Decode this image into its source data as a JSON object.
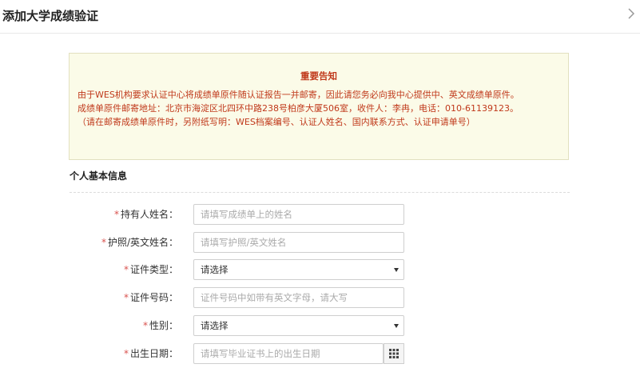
{
  "header": {
    "title": "添加大学成绩验证"
  },
  "notice": {
    "title": "重要告知",
    "lines": [
      "由于WES机构要求认证中心将成绩单原件随认证报告一并邮寄，因此请您务必向我中心提供中、英文成绩单原件。",
      "成绩单原件邮寄地址：北京市海淀区北四环中路238号柏彦大厦506室，收件人：李冉，电话：010-61139123。",
      "（请在邮寄成绩单原件时，另附纸写明：WES档案编号、认证人姓名、国内联系方式、认证申请单号）"
    ]
  },
  "section": {
    "title": "个人基本信息"
  },
  "form": {
    "required_mark": "*",
    "holder_name": {
      "label": "持有人姓名：",
      "placeholder": "请填写成绩单上的姓名"
    },
    "passport_name": {
      "label": "护照/英文姓名：",
      "placeholder": "请填写护照/英文姓名"
    },
    "id_type": {
      "label": "证件类型：",
      "value": "请选择"
    },
    "id_number": {
      "label": "证件号码：",
      "placeholder": "证件号码中如带有英文字母，请大写"
    },
    "gender": {
      "label": "性别：",
      "value": "请选择"
    },
    "birth_date": {
      "label": "出生日期：",
      "placeholder": "请填写毕业证书上的出生日期"
    }
  },
  "icons": {
    "close": "chevron-right-icon",
    "calendar": "calendar-grid-icon"
  }
}
